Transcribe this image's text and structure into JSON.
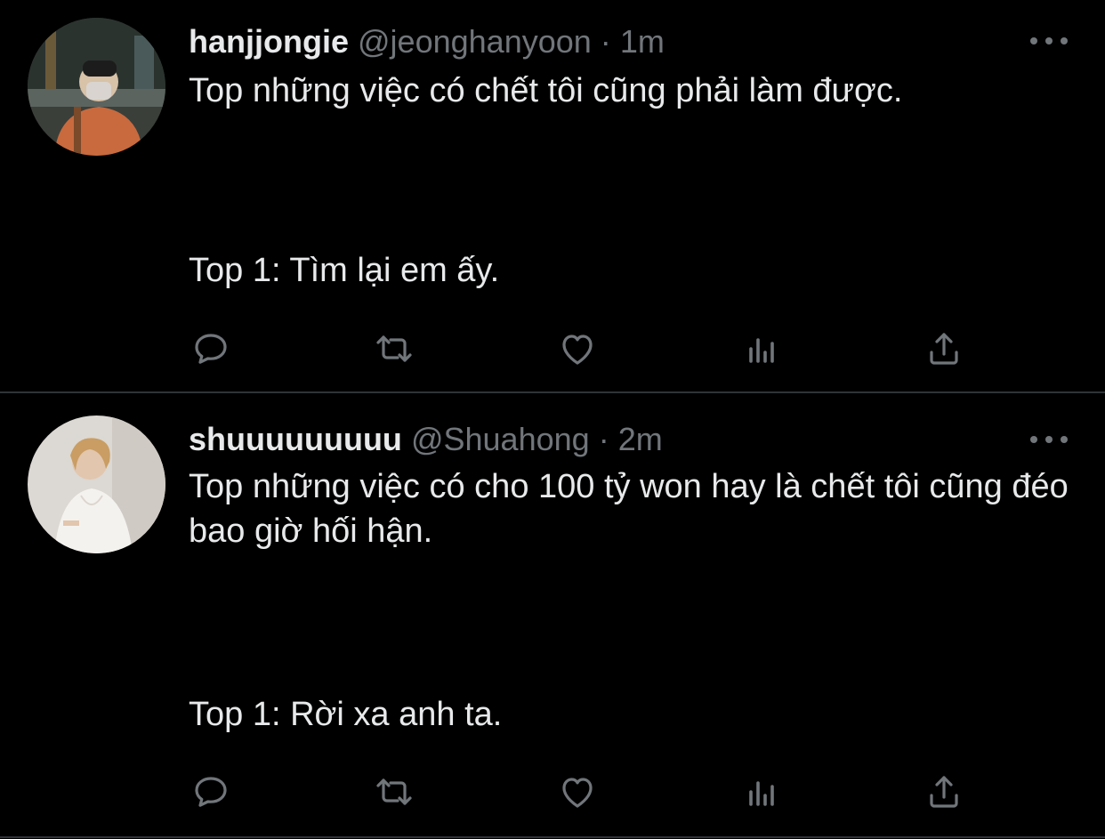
{
  "tweets": [
    {
      "display_name": "hanjjongie",
      "handle": "@jeonghanyoon",
      "separator": "·",
      "time": "1m",
      "text_line_1": "Top những việc có chết tôi cũng phải làm được.",
      "text_line_2": "Top 1: Tìm lại em ấy.",
      "avatar": "avatar-photo-person-mask-orange-shirt"
    },
    {
      "display_name": "shuuuuuuuuu",
      "handle": "@Shuahong",
      "separator": "·",
      "time": "2m",
      "text_line_1": "Top những việc có cho 100 tỷ won hay là chết tôi cũng đéo bao giờ hối hận.",
      "text_line_2": "Top 1: Rời xa anh ta.",
      "avatar": "avatar-photo-person-white-shirt"
    }
  ],
  "icons": {
    "reply": "reply-icon",
    "retweet": "retweet-icon",
    "like": "heart-icon",
    "views": "views-icon",
    "share": "share-icon",
    "more": "more-options-icon"
  },
  "colors": {
    "background": "#000000",
    "text_primary": "#e7e9ea",
    "text_secondary": "#71767b",
    "divider": "#2f3336"
  }
}
